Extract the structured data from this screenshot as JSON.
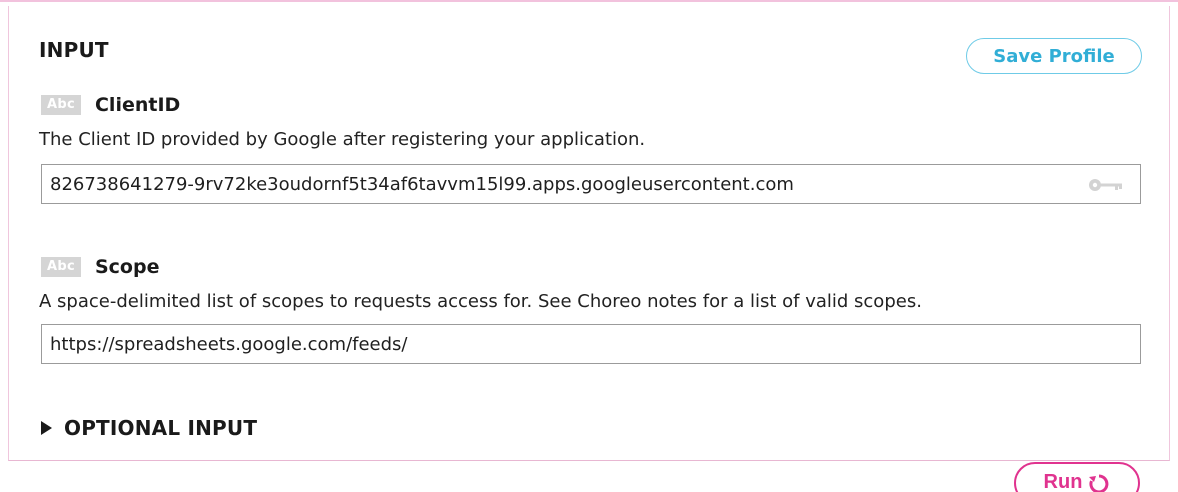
{
  "input_section": {
    "title": "INPUT",
    "save_profile_label": "Save Profile"
  },
  "fields": [
    {
      "type_badge": "Abc",
      "name": "ClientID",
      "description": "The Client ID provided by Google after registering your application.",
      "value": "826738641279-9rv72ke3oudornf5t34af6tavvm15l99.apps.googleusercontent.com",
      "icon": "key-icon"
    },
    {
      "type_badge": "Abc",
      "name": "Scope",
      "description": "A space-delimited list of scopes to requests access for. See Choreo notes for a list of valid scopes.",
      "value": "https://spreadsheets.google.com/feeds/"
    }
  ],
  "optional_section": {
    "label": "OPTIONAL INPUT",
    "expanded": false,
    "icon": "triangle-right-icon"
  },
  "run": {
    "label": "Run",
    "icon": "refresh-icon"
  },
  "colors": {
    "accent_blue": "#31aed6",
    "accent_pink": "#e0338f",
    "panel_border": "#f0c6dd",
    "badge_gray": "#d5d5d5"
  }
}
